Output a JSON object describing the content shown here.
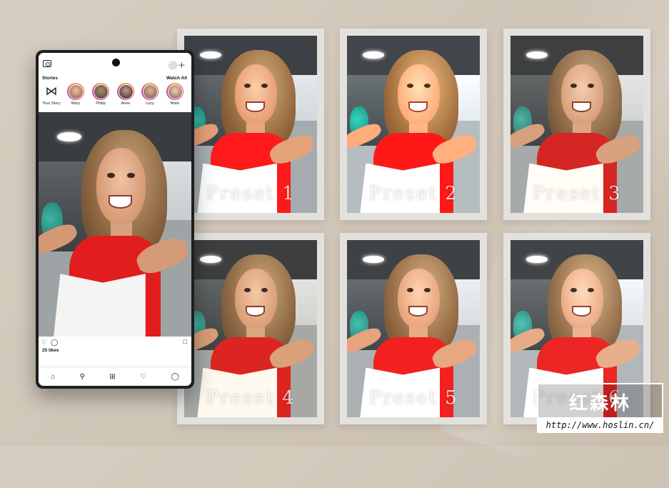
{
  "phone": {
    "stories_title": "Stories",
    "watch_all": "Watch All",
    "stories": [
      {
        "name": "Your Story"
      },
      {
        "name": "Mary"
      },
      {
        "name": "Philip"
      },
      {
        "name": "Anne"
      },
      {
        "name": "Lucy"
      },
      {
        "name": "Mark"
      }
    ],
    "likes": "25 likes"
  },
  "presets": [
    {
      "label": "Preset 1"
    },
    {
      "label": "Preset 2"
    },
    {
      "label": "Preset 3"
    },
    {
      "label": "Preset 4"
    },
    {
      "label": "Preset 5"
    },
    {
      "label": "Preset 6"
    }
  ],
  "watermark": {
    "cn": "红森林",
    "url": "http://www.hoslin.cn/"
  },
  "colors": {
    "background": "#d3c9bb",
    "card": "#e3e1de",
    "phone_body": "#1d1e20",
    "shirt": "#e21d1d"
  },
  "icons": [
    "camera-icon",
    "add-user-icon",
    "heart-icon",
    "comment-icon",
    "bookmark-icon",
    "home-icon",
    "search-icon",
    "add-post-icon",
    "activity-heart-icon",
    "profile-icon"
  ]
}
